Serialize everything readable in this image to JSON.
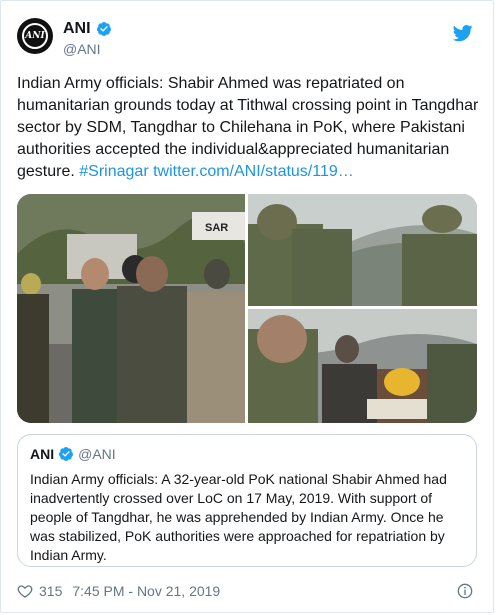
{
  "author": {
    "display_name": "ANI",
    "handle": "@ANI",
    "avatar_text": "ANI"
  },
  "tweet": {
    "text": "Indian Army officials: Shabir Ahmed was repatriated on humanitarian grounds today at Tithwal crossing point in Tangdhar sector by SDM, Tangdhar to Chilehana in PoK, where Pakistani authorities accepted the individual&appreciated humanitarian gesture.",
    "hashtag": "#Srinagar",
    "link": "twitter.com/ANI/status/119…"
  },
  "media": {
    "sign_text": "SAR"
  },
  "quoted": {
    "display_name": "ANI",
    "handle": "@ANI",
    "text": "Indian Army officials: A 32-year-old PoK national Shabir Ahmed had inadvertently crossed over LoC on 17 May, 2019. With support of people of Tangdhar, he was apprehended by Indian Army. Once he was stabilized, PoK authorities were approached for repatriation by Indian Army."
  },
  "footer": {
    "likes": "315",
    "timestamp": "7:45 PM - Nov 21, 2019"
  },
  "colors": {
    "verified": "#1da1f2",
    "link": "#1b95e0",
    "secondary": "#657786"
  },
  "icons": [
    "verified-icon",
    "twitter-bird-icon",
    "heart-icon",
    "info-icon"
  ]
}
